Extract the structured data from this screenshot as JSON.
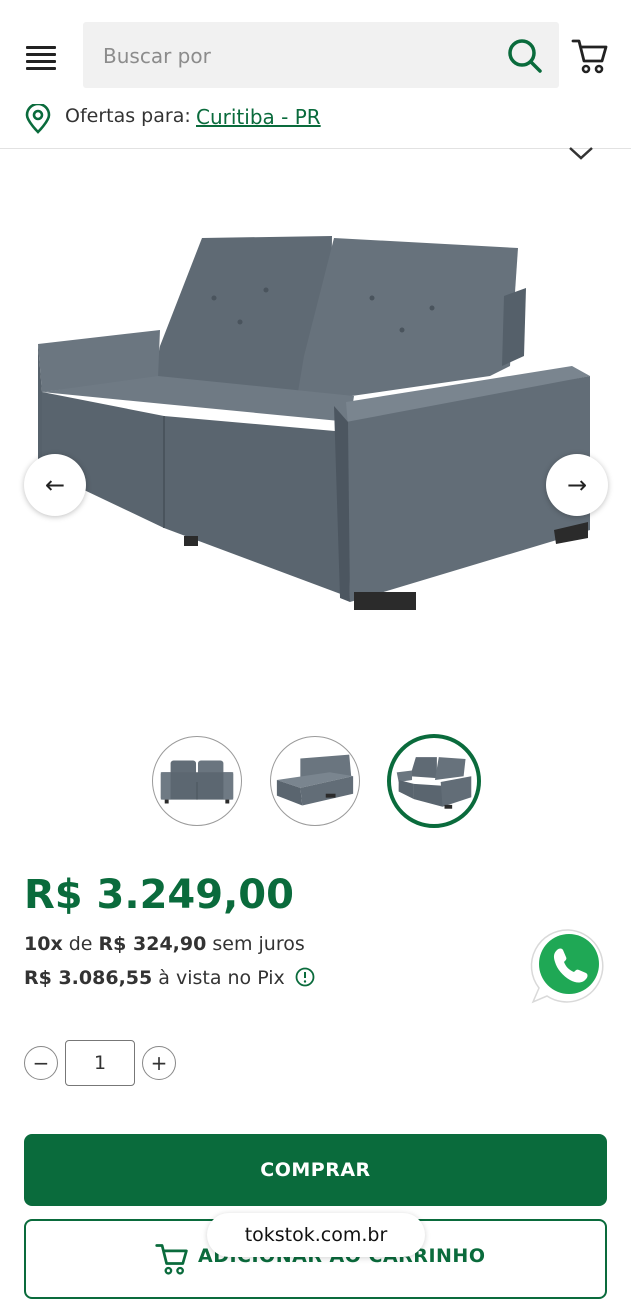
{
  "header": {
    "search_placeholder": "Buscar por",
    "icons": {
      "menu": "hamburger-icon",
      "search": "search-icon",
      "cart": "cart-icon",
      "location": "pin-icon"
    }
  },
  "location": {
    "label": "Ofertas para:",
    "city": "Curitiba - PR"
  },
  "gallery": {
    "prev_icon": "←",
    "next_icon": "→",
    "active_thumbnail": 3,
    "thumbnail_count": 3
  },
  "price": {
    "main": "R$ 3.249,00",
    "installment_count": "10x",
    "installment_prefix": "de",
    "installment_value": "R$ 324,90",
    "installment_suffix": "sem juros",
    "pix_value": "R$ 3.086,55",
    "pix_suffix": "à vista no Pix"
  },
  "quantity": {
    "minus": "−",
    "value": "1",
    "plus": "+"
  },
  "actions": {
    "buy": "COMPRAR",
    "add_to_cart": "ADICIONAR AO CARRINHO"
  },
  "browser": {
    "url": "tokstok.com.br"
  },
  "colors": {
    "brand_green": "#0a6b3c",
    "sofa_gray": "#5f6a74",
    "whatsapp_green": "#1fa855"
  }
}
